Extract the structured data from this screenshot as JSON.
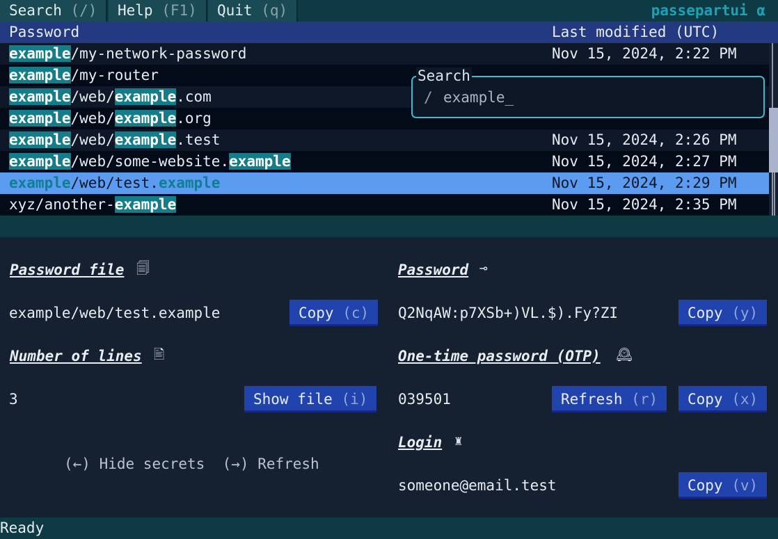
{
  "menu": {
    "search": {
      "label": "Search",
      "key": "(/)"
    },
    "help": {
      "label": "Help",
      "key": "(F1)"
    },
    "quit": {
      "label": "Quit",
      "key": "(q)"
    },
    "brand": "passepartui α"
  },
  "table": {
    "headers": {
      "password": "Password",
      "modified": "Last modified (UTC)"
    },
    "rows": [
      {
        "parts": [
          [
            "example",
            true
          ],
          [
            "/my-network-password",
            false
          ]
        ],
        "date": "Nov 15, 2024, 2:22 PM"
      },
      {
        "parts": [
          [
            "example",
            true
          ],
          [
            "/my-router",
            false
          ]
        ],
        "date": ""
      },
      {
        "parts": [
          [
            "example",
            true
          ],
          [
            "/web/",
            false
          ],
          [
            "example",
            true
          ],
          [
            ".com",
            false
          ]
        ],
        "date": ""
      },
      {
        "parts": [
          [
            "example",
            true
          ],
          [
            "/web/",
            false
          ],
          [
            "example",
            true
          ],
          [
            ".org",
            false
          ]
        ],
        "date": ""
      },
      {
        "parts": [
          [
            "example",
            true
          ],
          [
            "/web/",
            false
          ],
          [
            "example",
            true
          ],
          [
            ".test",
            false
          ]
        ],
        "date": "Nov 15, 2024, 2:26 PM"
      },
      {
        "parts": [
          [
            "example",
            true
          ],
          [
            "/web/some-website.",
            false
          ],
          [
            "example",
            true
          ]
        ],
        "date": "Nov 15, 2024, 2:27 PM"
      },
      {
        "parts": [
          [
            "example",
            true
          ],
          [
            "/web/test.",
            false
          ],
          [
            "example",
            true
          ]
        ],
        "date": "Nov 15, 2024, 2:29 PM",
        "selected": true
      },
      {
        "parts": [
          [
            "xyz/another-",
            false
          ],
          [
            "example",
            true
          ]
        ],
        "date": "Nov 15, 2024, 2:35 PM"
      }
    ]
  },
  "search": {
    "title": "Search",
    "prompt": "/",
    "value": "example_"
  },
  "details": {
    "password_file": {
      "label": "Password file",
      "icon": "file-icon",
      "value": "example/web/test.example",
      "copy": "Copy",
      "copy_key": "(c)"
    },
    "lines": {
      "label": "Number of lines",
      "icon": "lines-icon",
      "value": "3",
      "show": "Show file",
      "show_key": "(i)"
    },
    "password": {
      "label": "Password",
      "icon": "key-icon",
      "value": "Q2NqAW:p7XSb+)VL.$).Fy?ZI",
      "copy": "Copy",
      "copy_key": "(y)"
    },
    "otp": {
      "label": "One-time password (OTP)",
      "icon": "clock-icon",
      "value": "039501",
      "refresh": "Refresh",
      "refresh_key": "(r)",
      "copy": "Copy",
      "copy_key": "(x)"
    },
    "login": {
      "label": "Login",
      "icon": "user-icon",
      "value": "someone@email.test",
      "copy": "Copy",
      "copy_key": "(v)"
    },
    "hints": {
      "hide_key": "(←)",
      "hide": "Hide secrets",
      "refresh_key": "(→)",
      "refresh": "Refresh"
    }
  },
  "status": "Ready"
}
